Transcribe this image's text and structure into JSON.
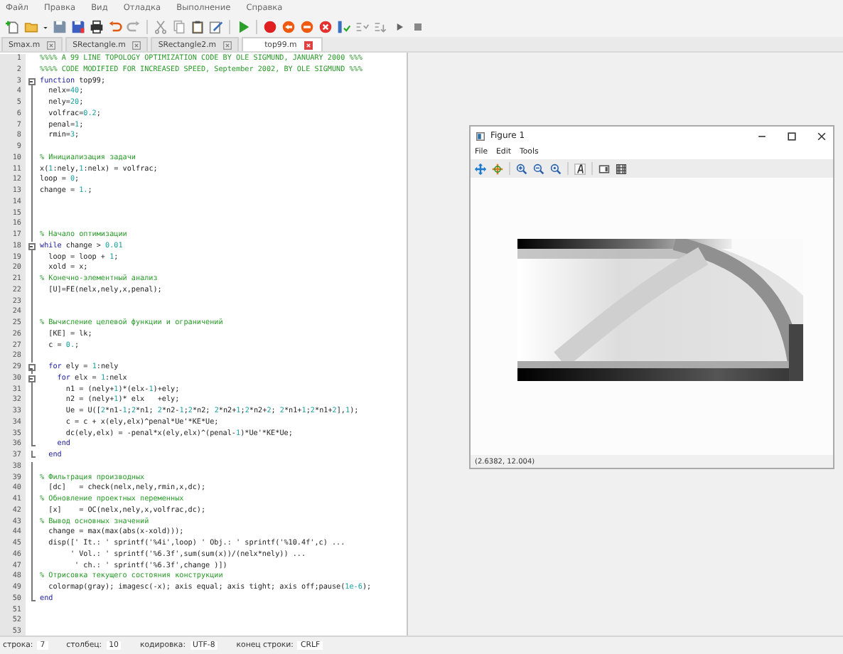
{
  "menu": [
    "Файл",
    "Правка",
    "Вид",
    "Отладка",
    "Выполнение",
    "Справка"
  ],
  "tabs": [
    {
      "label": "Smax.m",
      "selected": false
    },
    {
      "label": "SRectangle.m",
      "selected": false
    },
    {
      "label": "SRectangle2.m",
      "selected": false
    },
    {
      "label": "top99.m",
      "selected": true
    }
  ],
  "editor": {
    "lines": [
      {
        "number": "1",
        "kind": "unfolded",
        "segments": [
          {
            "kind": "comment",
            "text": "%%%% A 99 LINE TOPOLOGY OPTIMIZATION CODE BY OLE SIGMUND, JANUARY 2000 %%%"
          }
        ]
      },
      {
        "number": "2",
        "kind": "unfolded",
        "segments": [
          {
            "kind": "comment",
            "text": "%%%% CODE MODIFIED FOR INCREASED SPEED, September 2002, BY OLE SIGMUND %%%"
          }
        ]
      },
      {
        "number": "3",
        "kind": "start",
        "segments": [
          {
            "kind": "keyword",
            "text": "function"
          },
          {
            "kind": "plain",
            "text": " top99;"
          }
        ]
      },
      {
        "number": "4",
        "kind": "inner",
        "segments": [
          {
            "kind": "plain",
            "text": "  nelx="
          },
          {
            "kind": "number",
            "text": "40"
          },
          {
            "kind": "plain",
            "text": ";"
          }
        ]
      },
      {
        "number": "5",
        "kind": "inner",
        "segments": [
          {
            "kind": "plain",
            "text": "  nely="
          },
          {
            "kind": "number",
            "text": "20"
          },
          {
            "kind": "plain",
            "text": ";"
          }
        ]
      },
      {
        "number": "6",
        "kind": "inner",
        "segments": [
          {
            "kind": "plain",
            "text": "  volfrac="
          },
          {
            "kind": "number",
            "text": "0.2"
          },
          {
            "kind": "plain",
            "text": ";"
          }
        ]
      },
      {
        "number": "7",
        "kind": "inner",
        "segments": [
          {
            "kind": "plain",
            "text": "  penal="
          },
          {
            "kind": "number",
            "text": "1"
          },
          {
            "kind": "plain",
            "text": ";"
          }
        ]
      },
      {
        "number": "8",
        "kind": "inner",
        "segments": [
          {
            "kind": "plain",
            "text": "  rmin="
          },
          {
            "kind": "number",
            "text": "3"
          },
          {
            "kind": "plain",
            "text": ";"
          }
        ]
      },
      {
        "number": "9",
        "kind": "inner"
      },
      {
        "number": "10",
        "kind": "inner",
        "segments": [
          {
            "kind": "comment",
            "text": "% Инициализация задачи"
          }
        ]
      },
      {
        "number": "11",
        "kind": "inner",
        "segments": [
          {
            "kind": "plain",
            "text": "x("
          },
          {
            "kind": "number",
            "text": "1"
          },
          {
            "kind": "plain",
            "text": ":nely,"
          },
          {
            "kind": "number",
            "text": "1"
          },
          {
            "kind": "plain",
            "text": ":nelx) = volfrac;"
          }
        ]
      },
      {
        "number": "12",
        "kind": "inner",
        "segments": [
          {
            "kind": "plain",
            "text": "loop = "
          },
          {
            "kind": "number",
            "text": "0"
          },
          {
            "kind": "plain",
            "text": ";"
          }
        ]
      },
      {
        "number": "13",
        "kind": "inner",
        "segments": [
          {
            "kind": "plain",
            "text": "change = "
          },
          {
            "kind": "number",
            "text": "1."
          },
          {
            "kind": "plain",
            "text": ";"
          }
        ]
      },
      {
        "number": "14",
        "kind": "inner"
      },
      {
        "number": "15",
        "kind": "inner"
      },
      {
        "number": "16",
        "kind": "inner"
      },
      {
        "number": "17",
        "kind": "inner",
        "segments": [
          {
            "kind": "comment",
            "text": "% Начало оптимизации"
          }
        ]
      },
      {
        "number": "18",
        "kind": "start",
        "segments": [
          {
            "kind": "keyword",
            "text": "while"
          },
          {
            "kind": "plain",
            "text": " change > "
          },
          {
            "kind": "number",
            "text": "0.01"
          }
        ]
      },
      {
        "number": "19",
        "kind": "inner",
        "segments": [
          {
            "kind": "plain",
            "text": "  loop = loop + "
          },
          {
            "kind": "number",
            "text": "1"
          },
          {
            "kind": "plain",
            "text": ";"
          }
        ]
      },
      {
        "number": "20",
        "kind": "inner",
        "segments": [
          {
            "kind": "plain",
            "text": "  xold = x;"
          }
        ]
      },
      {
        "number": "21",
        "kind": "inner",
        "segments": [
          {
            "kind": "comment",
            "text": "% Конечно-элементный анализ"
          }
        ]
      },
      {
        "number": "22",
        "kind": "inner",
        "segments": [
          {
            "kind": "plain",
            "text": "  [U]=FE(nelx,nely,x,penal);"
          }
        ]
      },
      {
        "number": "23",
        "kind": "inner"
      },
      {
        "number": "24",
        "kind": "inner"
      },
      {
        "number": "25",
        "kind": "inner",
        "segments": [
          {
            "kind": "comment",
            "text": "% Вычисление целевой функции и ограничений"
          }
        ]
      },
      {
        "number": "26",
        "kind": "inner",
        "segments": [
          {
            "kind": "plain",
            "text": "  [KE] = lk;"
          }
        ]
      },
      {
        "number": "27",
        "kind": "inner",
        "segments": [
          {
            "kind": "plain",
            "text": "  c = "
          },
          {
            "kind": "number",
            "text": "0."
          },
          {
            "kind": "plain",
            "text": ";"
          }
        ]
      },
      {
        "number": "28",
        "kind": "inner"
      },
      {
        "number": "29",
        "kind": "start",
        "segments": [
          {
            "kind": "keyword",
            "text": "  for"
          },
          {
            "kind": "plain",
            "text": " ely = "
          },
          {
            "kind": "number",
            "text": "1"
          },
          {
            "kind": "plain",
            "text": ":nely"
          }
        ]
      },
      {
        "number": "30",
        "kind": "start",
        "segments": [
          {
            "kind": "keyword",
            "text": "    for"
          },
          {
            "kind": "plain",
            "text": " elx = "
          },
          {
            "kind": "number",
            "text": "1"
          },
          {
            "kind": "plain",
            "text": ":nelx"
          }
        ]
      },
      {
        "number": "31",
        "kind": "inner",
        "segments": [
          {
            "kind": "plain",
            "text": "      n1 = (nely+"
          },
          {
            "kind": "number",
            "text": "1"
          },
          {
            "kind": "plain",
            "text": ")*(elx-"
          },
          {
            "kind": "number",
            "text": "1"
          },
          {
            "kind": "plain",
            "text": ")+ely;"
          }
        ]
      },
      {
        "number": "32",
        "kind": "inner",
        "segments": [
          {
            "kind": "plain",
            "text": "      n2 = (nely+"
          },
          {
            "kind": "number",
            "text": "1"
          },
          {
            "kind": "plain",
            "text": ")* elx   +ely;"
          }
        ]
      },
      {
        "number": "33",
        "kind": "inner",
        "segments": [
          {
            "kind": "plain",
            "text": "      Ue = U(["
          },
          {
            "kind": "number",
            "text": "2"
          },
          {
            "kind": "plain",
            "text": "*n1-"
          },
          {
            "kind": "number",
            "text": "1"
          },
          {
            "kind": "plain",
            "text": ";"
          },
          {
            "kind": "number",
            "text": "2"
          },
          {
            "kind": "plain",
            "text": "*n1; "
          },
          {
            "kind": "number",
            "text": "2"
          },
          {
            "kind": "plain",
            "text": "*n2-"
          },
          {
            "kind": "number",
            "text": "1"
          },
          {
            "kind": "plain",
            "text": ";"
          },
          {
            "kind": "number",
            "text": "2"
          },
          {
            "kind": "plain",
            "text": "*n2; "
          },
          {
            "kind": "number",
            "text": "2"
          },
          {
            "kind": "plain",
            "text": "*n2+"
          },
          {
            "kind": "number",
            "text": "1"
          },
          {
            "kind": "plain",
            "text": ";"
          },
          {
            "kind": "number",
            "text": "2"
          },
          {
            "kind": "plain",
            "text": "*n2+"
          },
          {
            "kind": "number",
            "text": "2"
          },
          {
            "kind": "plain",
            "text": "; "
          },
          {
            "kind": "number",
            "text": "2"
          },
          {
            "kind": "plain",
            "text": "*n1+"
          },
          {
            "kind": "number",
            "text": "1"
          },
          {
            "kind": "plain",
            "text": ";"
          },
          {
            "kind": "number",
            "text": "2"
          },
          {
            "kind": "plain",
            "text": "*n1+"
          },
          {
            "kind": "number",
            "text": "2"
          },
          {
            "kind": "plain",
            "text": "],"
          },
          {
            "kind": "number",
            "text": "1"
          },
          {
            "kind": "plain",
            "text": ");"
          }
        ]
      },
      {
        "number": "34",
        "kind": "inner",
        "segments": [
          {
            "kind": "plain",
            "text": "      c = c + x(ely,elx)^penal*Ue'*KE*Ue;"
          }
        ]
      },
      {
        "number": "35",
        "kind": "inner",
        "segments": [
          {
            "kind": "plain",
            "text": "      dc(ely,elx) = -penal*x(ely,elx)^(penal-"
          },
          {
            "kind": "number",
            "text": "1"
          },
          {
            "kind": "plain",
            "text": ")*Ue'*KE*Ue;"
          }
        ]
      },
      {
        "number": "36",
        "kind": "end",
        "segments": [
          {
            "kind": "keyword",
            "text": "    end"
          }
        ]
      },
      {
        "number": "37",
        "kind": "end",
        "segments": [
          {
            "kind": "keyword",
            "text": "  end"
          }
        ]
      },
      {
        "number": "38",
        "kind": "inner"
      },
      {
        "number": "39",
        "kind": "inner",
        "segments": [
          {
            "kind": "comment",
            "text": "% Фильтрация производных"
          }
        ]
      },
      {
        "number": "40",
        "kind": "inner",
        "segments": [
          {
            "kind": "plain",
            "text": "  [dc]   = check(nelx,nely,rmin,x,dc);"
          }
        ]
      },
      {
        "number": "41",
        "kind": "inner",
        "segments": [
          {
            "kind": "comment",
            "text": "% Обновление проектных переменных"
          }
        ]
      },
      {
        "number": "42",
        "kind": "inner",
        "segments": [
          {
            "kind": "plain",
            "text": "  [x]    = OC(nelx,nely,x,volfrac,dc);"
          }
        ]
      },
      {
        "number": "43",
        "kind": "inner",
        "segments": [
          {
            "kind": "comment",
            "text": "% Вывод основных значений"
          }
        ]
      },
      {
        "number": "44",
        "kind": "inner",
        "segments": [
          {
            "kind": "plain",
            "text": "  change = max(max(abs(x-xold)));"
          }
        ]
      },
      {
        "number": "45",
        "kind": "inner",
        "segments": [
          {
            "kind": "plain",
            "text": "  disp([' It.: ' sprintf('%4i',loop) ' Obj.: ' sprintf('%10.4f',c) ..."
          }
        ]
      },
      {
        "number": "46",
        "kind": "inner",
        "segments": [
          {
            "kind": "plain",
            "text": "       ' Vol.: ' sprintf('%6.3f',sum(sum(x))/(nelx*nely)) ..."
          }
        ]
      },
      {
        "number": "47",
        "kind": "inner",
        "segments": [
          {
            "kind": "plain",
            "text": "        ' ch.: ' sprintf('%6.3f',change )])"
          }
        ]
      },
      {
        "number": "48",
        "kind": "inner",
        "segments": [
          {
            "kind": "comment",
            "text": "% Отрисовка текущего состояния конструкции"
          }
        ]
      },
      {
        "number": "49",
        "kind": "inner",
        "segments": [
          {
            "kind": "plain",
            "text": "  colormap(gray); imagesc(-x); axis equal; axis tight; axis off;pause("
          },
          {
            "kind": "number",
            "text": "1e-6"
          },
          {
            "kind": "plain",
            "text": ");"
          }
        ]
      },
      {
        "number": "50",
        "kind": "end",
        "segments": [
          {
            "kind": "keyword",
            "text": "end"
          }
        ]
      },
      {
        "number": "51",
        "kind": "unfolded"
      },
      {
        "number": "52",
        "kind": "unfolded"
      },
      {
        "number": "53",
        "kind": "unfolded"
      }
    ]
  },
  "figure": {
    "title": "Figure 1",
    "menu": [
      "File",
      "Edit",
      "Tools"
    ],
    "coordinates": "(2.6382, 12.004)"
  },
  "status_bar": [
    {
      "label": "строка:",
      "value": "7"
    },
    {
      "label": "столбец:",
      "value": "10"
    },
    {
      "label": "кодировка:",
      "value": "UTF-8"
    },
    {
      "label": "конец строки:",
      "value": "CRLF"
    }
  ]
}
